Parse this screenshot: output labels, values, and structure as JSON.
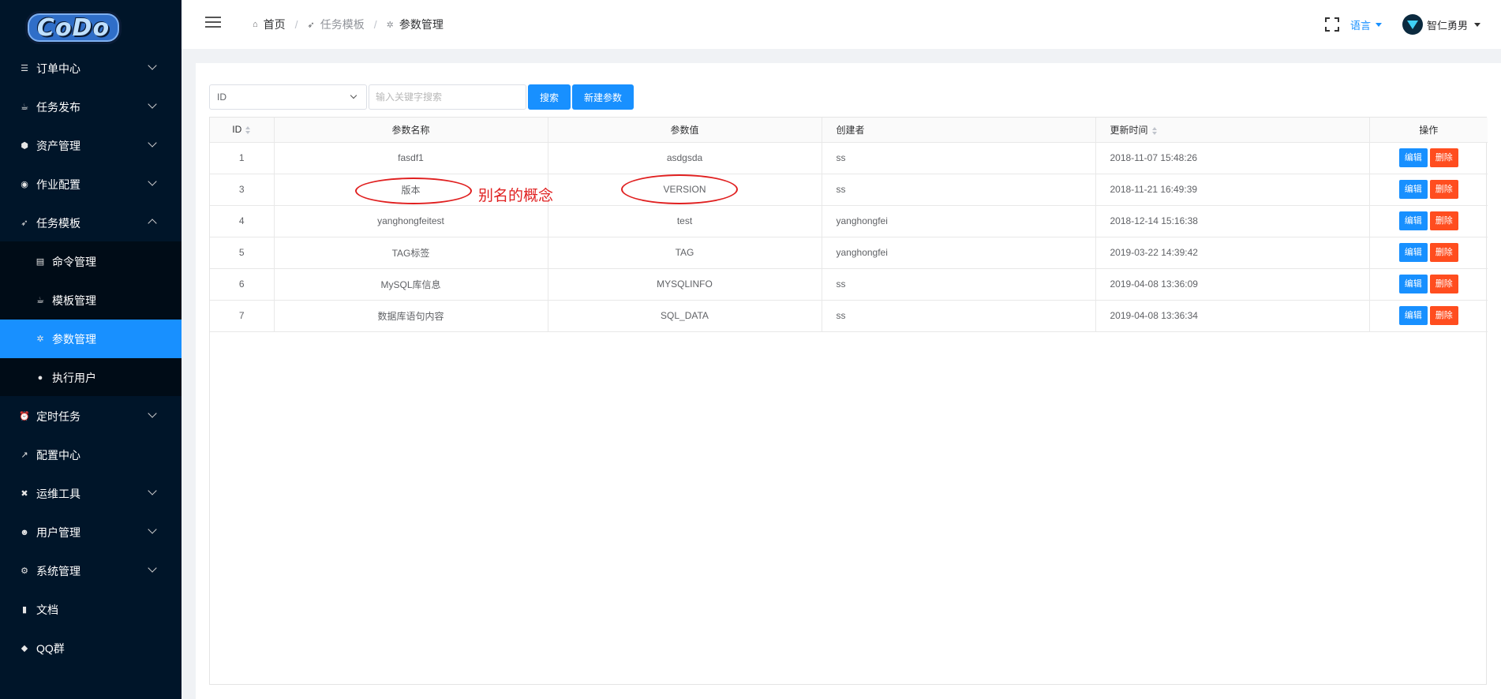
{
  "logo": {
    "text": "CoDo"
  },
  "sidebar": {
    "items": [
      {
        "label": "订单中心",
        "icon": "list-icon",
        "glyph": "☰",
        "expand": "down"
      },
      {
        "label": "任务发布",
        "icon": "coffee-icon",
        "glyph": "☕",
        "expand": "down"
      },
      {
        "label": "资产管理",
        "icon": "cube-icon",
        "glyph": "⬢",
        "expand": "down"
      },
      {
        "label": "作业配置",
        "icon": "database-icon",
        "glyph": "◉",
        "expand": "down"
      },
      {
        "label": "任务模板",
        "icon": "rocket-icon",
        "glyph": "➶",
        "expand": "up"
      },
      {
        "label": "命令管理",
        "icon": "file-icon",
        "glyph": "▤",
        "sub": true
      },
      {
        "label": "模板管理",
        "icon": "coffee-icon",
        "glyph": "☕",
        "sub": true
      },
      {
        "label": "参数管理",
        "icon": "snowflake-icon",
        "glyph": "✲",
        "sub": true,
        "active": true
      },
      {
        "label": "执行用户",
        "icon": "user-circle-icon",
        "glyph": "●",
        "sub": true
      },
      {
        "label": "定时任务",
        "icon": "alarm-icon",
        "glyph": "⏰",
        "expand": "down"
      },
      {
        "label": "配置中心",
        "icon": "wrench-icon",
        "glyph": "↗"
      },
      {
        "label": "运维工具",
        "icon": "tools-icon",
        "glyph": "✖",
        "expand": "down"
      },
      {
        "label": "用户管理",
        "icon": "users-icon",
        "glyph": "☻",
        "expand": "down"
      },
      {
        "label": "系统管理",
        "icon": "gear-icon",
        "glyph": "⚙",
        "expand": "down"
      },
      {
        "label": "文档",
        "icon": "book-icon",
        "glyph": "▮"
      },
      {
        "label": "QQ群",
        "icon": "bell-icon",
        "glyph": "◆"
      }
    ]
  },
  "breadcrumb": {
    "home": "首页",
    "parent": "任务模板",
    "current": "参数管理"
  },
  "header": {
    "language": "语言",
    "username": "智仁勇男"
  },
  "toolbar": {
    "select_value": "ID",
    "search_placeholder": "输入关键字搜索",
    "search_label": "搜索",
    "new_label": "新建参数"
  },
  "table": {
    "headers": {
      "id": "ID",
      "name": "参数名称",
      "value": "参数值",
      "creator": "创建者",
      "updated": "更新时间",
      "actions": "操作"
    },
    "edit_label": "编辑",
    "delete_label": "删除",
    "rows": [
      {
        "id": "1",
        "name": "fasdf1",
        "value": "asdgsda",
        "creator": "ss",
        "updated": "2018-11-07 15:48:26"
      },
      {
        "id": "3",
        "name": "版本",
        "value": "VERSION",
        "creator": "ss",
        "updated": "2018-11-21 16:49:39"
      },
      {
        "id": "4",
        "name": "yanghongfeitest",
        "value": "test",
        "creator": "yanghongfei",
        "updated": "2018-12-14 15:16:38"
      },
      {
        "id": "5",
        "name": "TAG标签",
        "value": "TAG",
        "creator": "yanghongfei",
        "updated": "2019-03-22 14:39:42"
      },
      {
        "id": "6",
        "name": "MySQL库信息",
        "value": "MYSQLINFO",
        "creator": "ss",
        "updated": "2019-04-08 13:36:09"
      },
      {
        "id": "7",
        "name": "数据库语句内容",
        "value": "SQL_DATA",
        "creator": "ss",
        "updated": "2019-04-08 13:36:34"
      }
    ]
  },
  "annotation": {
    "text": "别名的概念",
    "color": "#e02020"
  },
  "colors": {
    "primary": "#1890ff",
    "danger": "#ff4d1f",
    "sidebar": "#001529",
    "submenu": "#000c17"
  }
}
